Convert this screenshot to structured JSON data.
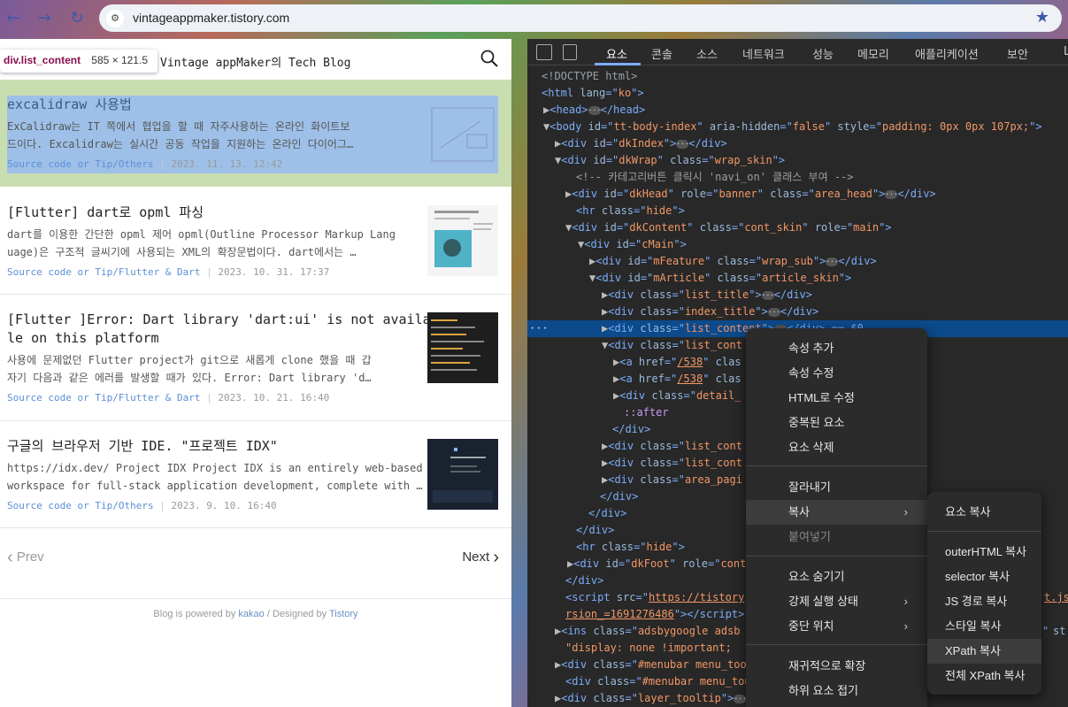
{
  "browser": {
    "url": "vintageappmaker.tistory.com"
  },
  "blog": {
    "title": "Vintage appMaker의 Tech Blog",
    "tooltip": {
      "selector": "div.list_content",
      "size": "585 × 121.5"
    },
    "articles": [
      {
        "title": "excalidraw 사용법",
        "desc1": "ExCalidraw는 IT 쪽에서 협업을 할 때 자주사용하는 온라인 화이트보",
        "desc2": "드이다. Excalidraw는 실시간 공동 작업을 지원하는 온라인 다이어그…",
        "category": "Source code or Tip/Others",
        "date": "2023. 11. 13. 12:42"
      },
      {
        "title": "[Flutter] dart로 opml 파싱",
        "desc1": "dart를 이용한 간단한 opml 제어 opml(Outline Processor Markup Lang",
        "desc2": "uage)은 구조적 글씨기에 사용되는 XML의 확장문법이다. dart에서는 …",
        "category": "Source code or Tip/Flutter & Dart",
        "date": "2023. 10. 31. 17:37"
      },
      {
        "title1": "[Flutter ]Error: Dart library 'dart:ui' is not availab",
        "title2": "le on this platform",
        "desc1": "사용에 문제없던 Flutter project가 git으로 새롭게 clone 했을 때 갑",
        "desc2": "자기 다음과 같은 에러를 발생할 때가 있다. Error: Dart library 'd…",
        "category": "Source code or Tip/Flutter & Dart",
        "date": "2023. 10. 21. 16:40"
      },
      {
        "title": "구글의 브라우저 기반 IDE. \"프로젝트 IDX\"",
        "desc1": "https://idx.dev/ Project IDX Project IDX is an entirely web-based",
        "desc2": "workspace for full-stack application development, complete with …",
        "category": "Source code or Tip/Others",
        "date": "2023. 9. 10. 16:40"
      }
    ],
    "pager": {
      "prev": "Prev",
      "next": "Next"
    },
    "footer": {
      "prefix": "Blog is powered by ",
      "kakao": "kakao",
      "mid": " / Designed by ",
      "tistory": "Tistory"
    }
  },
  "devtools": {
    "tabs": [
      "요소",
      "콘솔",
      "소스",
      "네트워크",
      "성능",
      "메모리",
      "애플리케이션",
      "보안",
      "L"
    ],
    "tree": {
      "l0": "<!DOCTYPE html>",
      "l1a": "<html ",
      "l1b": "lang",
      "l1c": "=\"",
      "l1d": "ko",
      "l1e": "\">",
      "l2a": "<head>",
      "l2b": "</head>",
      "l3a": "<body ",
      "l3b": "id",
      "l3c": "tt-body-index",
      "l3d": "aria-hidden",
      "l3e": "false",
      "l3f": "style",
      "l3g": "padding: 0px 0px 107px;",
      "l4": "dkIndex",
      "l5a": "dkWrap",
      "l5b": "wrap_skin",
      "l6": "<!-- 카테고리버튼 클릭시 'navi_on' 클래스 부여 -->",
      "l7a": "dkHead",
      "l7b": "banner",
      "l7c": "area_head",
      "l8": "hide",
      "l9a": "dkContent",
      "l9b": "cont_skin",
      "l9c": "main",
      "l10": "cMain",
      "l11a": "mFeature",
      "l11b": "wrap_sub",
      "l12a": "mArticle",
      "l12b": "article_skin",
      "l13": "list_title",
      "l14": "index_title",
      "l15": "list_content",
      "l15tail": "</div> == $0",
      "l16": "list_cont",
      "l17a": "/538",
      "l18a": "/538",
      "l19": "detail_",
      "l20": "::after",
      "l21": "</div>",
      "l22": "list_cont",
      "l23": "list_cont",
      "l24": "area_pagi",
      "l25": "</div>",
      "l26": "</div>",
      "l27": "</div>",
      "l28": "hide",
      "l29a": "dkFoot",
      "l29b": "cont",
      "l30": "</div>",
      "l31a": "https://tistory",
      "l31b": "t.js",
      "l32": "rsion_=1691276486",
      "l33a": "adsbygoogle adsb",
      "l33b": "st",
      "l34": "display: none !important; ",
      "l35": "#menubar menu_too",
      "l36": "#menubar menu_tou",
      "l37": "layer_tooltip"
    }
  },
  "context_menu": {
    "items": [
      "속성 추가",
      "속성 수정",
      "HTML로 수정",
      "중복된 요소",
      "요소 삭제",
      "잘라내기",
      "복사",
      "붙여넣기",
      "요소 숨기기",
      "강제 실행 상태",
      "중단 위치",
      "재귀적으로 확장",
      "하위 요소 접기"
    ]
  },
  "copy_submenu": {
    "items": [
      "요소 복사",
      "outerHTML 복사",
      "selector 복사",
      "JS 경로 복사",
      "스타일 복사",
      "XPath 복사",
      "전체 XPath 복사"
    ]
  }
}
